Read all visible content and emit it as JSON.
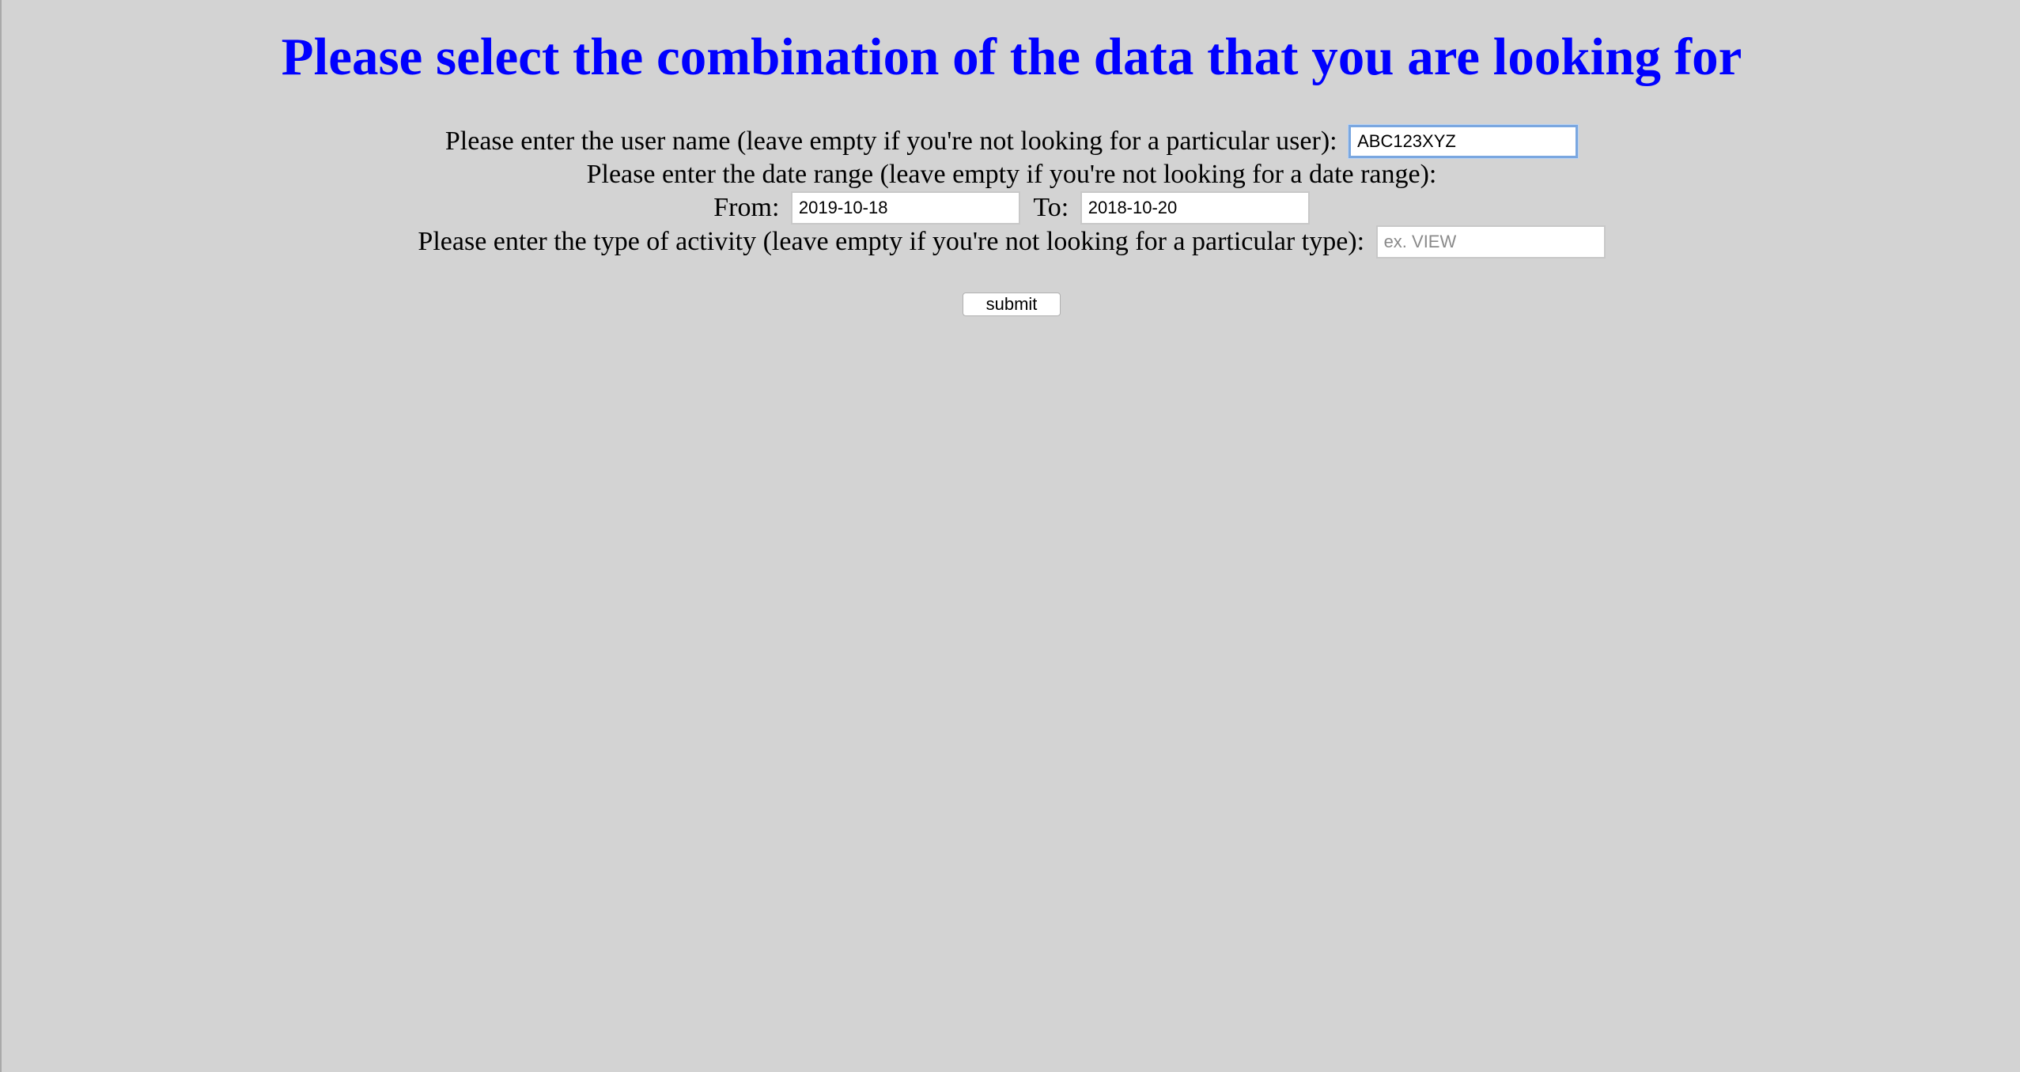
{
  "page": {
    "title": "Please select the combination of the data that you are looking for"
  },
  "form": {
    "user": {
      "label": "Please enter the user name (leave empty if you're not looking for a particular user):",
      "value": "ABC123XYZ"
    },
    "date_range": {
      "label": "Please enter the date range (leave empty if you're not looking for a date range):",
      "from_label": "From:",
      "from_value": "2019-10-18",
      "to_label": "To:",
      "to_value": "2018-10-20"
    },
    "activity": {
      "label": "Please enter the type of activity (leave empty if you're not looking for a particular type):",
      "value": "",
      "placeholder": "ex. VIEW"
    },
    "submit_label": "submit"
  },
  "colors": {
    "background": "#d3d3d3",
    "title": "#0000ff",
    "focus_ring": "#7aa7e0"
  }
}
